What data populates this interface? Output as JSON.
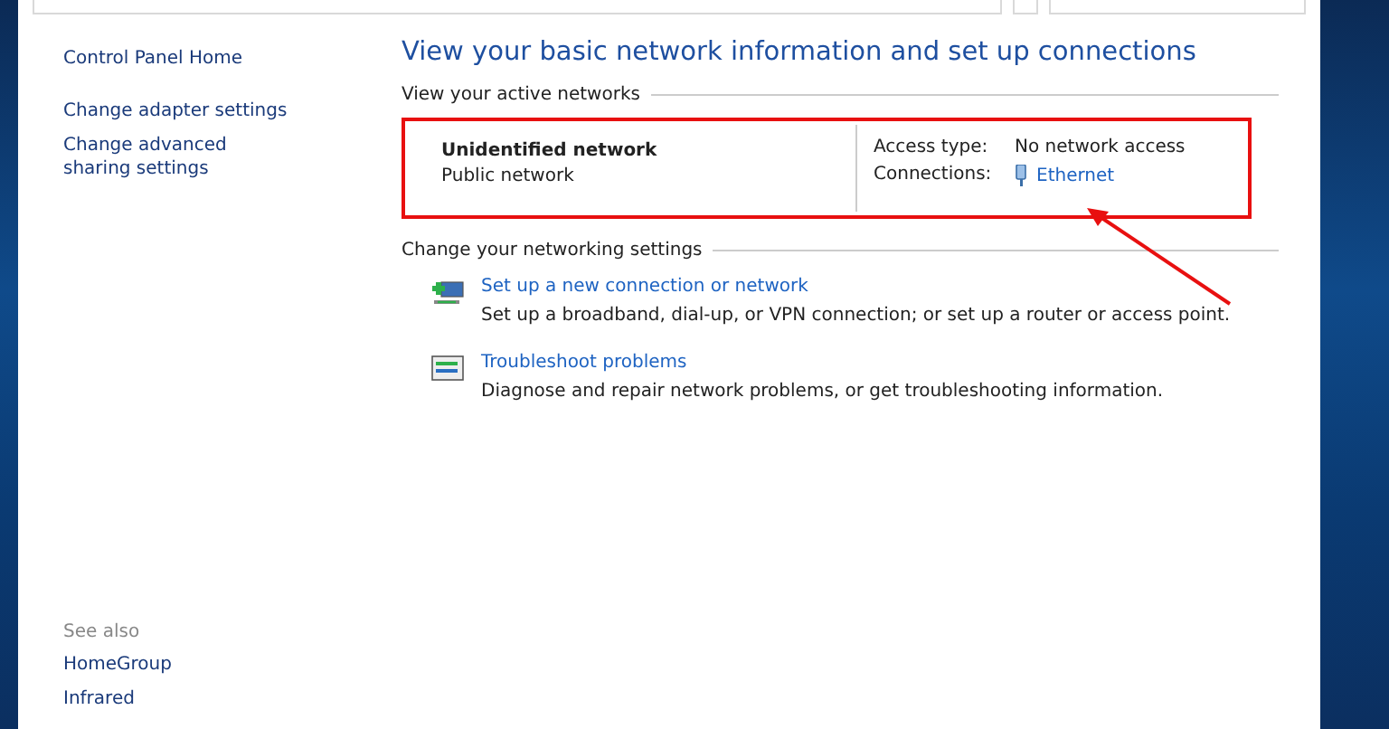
{
  "sidebar": {
    "items": [
      {
        "label": "Control Panel Home"
      },
      {
        "label": "Change adapter settings"
      },
      {
        "label": "Change advanced sharing settings"
      }
    ],
    "see_also": {
      "heading": "See also",
      "items": [
        "HomeGroup",
        "Infrared"
      ]
    }
  },
  "main": {
    "title": "View your basic network information and set up connections",
    "active_networks": {
      "heading": "View your active networks",
      "network_name": "Unidentified network",
      "network_type": "Public network",
      "access_type_label": "Access type:",
      "access_type": "No network access",
      "connections_label": "Connections:",
      "connection": "Ethernet"
    },
    "settings": {
      "heading": "Change your networking settings",
      "items": [
        {
          "kind": "new-connection",
          "link": "Set up a new connection or network",
          "description": "Set up a broadband, dial-up, or VPN connection; or set up a router or access point."
        },
        {
          "kind": "troubleshoot",
          "link": "Troubleshoot problems",
          "description": "Diagnose and repair network problems, or get troubleshooting information."
        }
      ]
    }
  }
}
